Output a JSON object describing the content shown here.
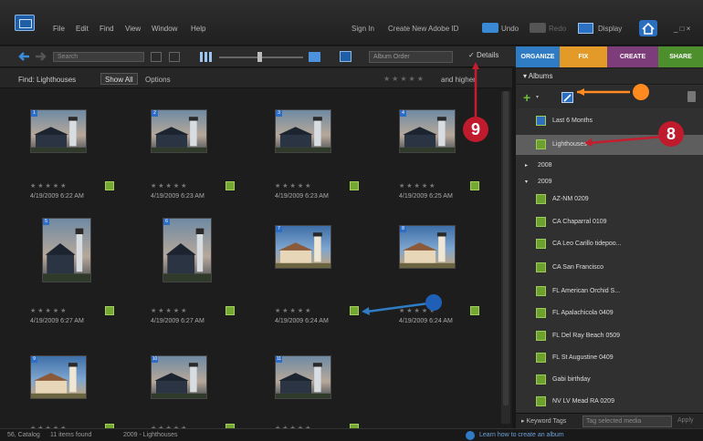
{
  "menubar": {
    "items": [
      "File",
      "Edit",
      "Find",
      "View",
      "Window",
      "Help"
    ],
    "sign_in": "Sign In",
    "create_id": "Create New Adobe ID",
    "undo": "Undo",
    "redo": "Redo",
    "display": "Display",
    "window_controls": "_ □ ×"
  },
  "toolbar": {
    "search_placeholder": "Search",
    "sort": "Album Order",
    "details": "Details"
  },
  "tabs": [
    {
      "label": "ORGANIZE",
      "color": "#2f7bc4"
    },
    {
      "label": "FIX",
      "color": "#e39a29"
    },
    {
      "label": "CREATE",
      "color": "#7d3c7a"
    },
    {
      "label": "SHARE",
      "color": "#4e8f2d"
    }
  ],
  "findbar": {
    "find": "Find: Lighthouses",
    "show_all": "Show All",
    "options": "Options",
    "rating_filter": "and higher"
  },
  "photos": [
    {
      "num": "1",
      "date": "4/19/2009 6:22 AM",
      "type": "wide"
    },
    {
      "num": "2",
      "date": "4/19/2009 6:23 AM",
      "type": "wide"
    },
    {
      "num": "3",
      "date": "4/19/2009 6:23 AM",
      "type": "wide"
    },
    {
      "num": "4",
      "date": "4/19/2009 6:25 AM",
      "type": "wide"
    },
    {
      "num": "5",
      "date": "4/19/2009 6:27 AM",
      "type": "tall"
    },
    {
      "num": "6",
      "date": "4/19/2009 6:27 AM",
      "type": "tall"
    },
    {
      "num": "7",
      "date": "4/19/2009 6:24 AM",
      "type": "wide"
    },
    {
      "num": "8",
      "date": "4/19/2009 6:24 AM",
      "type": "wide"
    },
    {
      "num": "9",
      "date": "",
      "type": "wide"
    },
    {
      "num": "10",
      "date": "",
      "type": "wide"
    },
    {
      "num": "11",
      "date": "",
      "type": "wide"
    }
  ],
  "panel": {
    "albums_title": "Albums",
    "albums": [
      {
        "label": "Last 6 Months",
        "color": "#2f6fc0",
        "indent": 22
      },
      {
        "label": "Lighthouses",
        "color": "#6ea02f",
        "indent": 22,
        "selected": true
      },
      {
        "label": "2008",
        "color": "",
        "indent": 10,
        "group": true,
        "collapsed": true
      },
      {
        "label": "2009",
        "color": "",
        "indent": 10,
        "group": true
      },
      {
        "label": "AZ-NM 0209",
        "color": "#6ea02f",
        "indent": 22
      },
      {
        "label": "CA Chaparral 0109",
        "color": "#6ea02f",
        "indent": 22
      },
      {
        "label": "CA Leo Carillo tidepoo...",
        "color": "#6ea02f",
        "indent": 22
      },
      {
        "label": "CA San Francisco",
        "color": "#6ea02f",
        "indent": 22
      },
      {
        "label": "FL American Orchid S...",
        "color": "#6ea02f",
        "indent": 22
      },
      {
        "label": "FL Apalachicola 0409",
        "color": "#6ea02f",
        "indent": 22
      },
      {
        "label": "FL Del Ray Beach 0509",
        "color": "#6ea02f",
        "indent": 22
      },
      {
        "label": "FL St Augustine 0409",
        "color": "#6ea02f",
        "indent": 22
      },
      {
        "label": "Gabi birthday",
        "color": "#6ea02f",
        "indent": 22
      },
      {
        "label": "NV LV Mead RA 0209",
        "color": "#6ea02f",
        "indent": 22
      }
    ],
    "keyword_label": "Keyword Tags",
    "keyword_placeholder": "Tag selected media",
    "apply": "Apply"
  },
  "status": {
    "left": "56, Catalog",
    "count": "11 items found",
    "middle": "2009 - Lighthouses",
    "right": "Learn how to create an album"
  },
  "callouts": {
    "eight": "8",
    "nine": "9"
  }
}
